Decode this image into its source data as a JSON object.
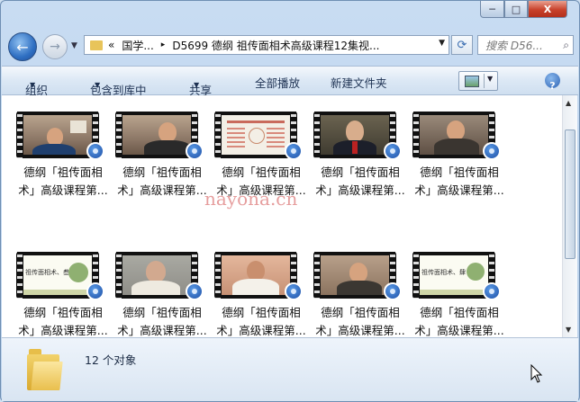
{
  "window": {
    "controls": {
      "minimize": "─",
      "maximize": "□",
      "close": "X"
    }
  },
  "nav": {
    "back_icon": "←",
    "forward_icon": "→",
    "history_dropdown": "▼"
  },
  "address": {
    "overflow": "«",
    "segment1": "国学...",
    "separator": "▸",
    "segment2": "D5699 德纲 祖传面相术高级课程12集视...",
    "dropdown": "▼"
  },
  "refresh_icon": "⟳",
  "search": {
    "placeholder": "搜索 D56...",
    "icon": "⌕"
  },
  "toolbar": {
    "organize": "组织",
    "include_in_library": "包含到库中",
    "share": "共享",
    "play_all": "全部播放",
    "new_folder": "新建文件夹",
    "dropdown_arrow": "▼",
    "help": "?"
  },
  "files": [
    {
      "line1": "德纲「祖传面相",
      "line2": "术」高级课程第..."
    },
    {
      "line1": "德纲「祖传面相",
      "line2": "术」高级课程第..."
    },
    {
      "line1": "德纲「祖传面相",
      "line2": "术」高级课程第..."
    },
    {
      "line1": "德纲「祖传面相",
      "line2": "术」高级课程第..."
    },
    {
      "line1": "德纲「祖传面相",
      "line2": "术」高级课程第..."
    },
    {
      "line1": "德纲「祖传面相",
      "line2": "术」高级课程第..."
    },
    {
      "line1": "德纲「祖传面相",
      "line2": "术」高级课程第..."
    },
    {
      "line1": "德纲「祖传面相",
      "line2": "术」高级课程第..."
    },
    {
      "line1": "德纲「祖传面相",
      "line2": "术」高级课程第..."
    },
    {
      "line1": "德纲「祖传面相",
      "line2": "术」高级课程第..."
    }
  ],
  "slide_text": {
    "a": "祖传面相术、叁",
    "b": "祖传面相术、肆"
  },
  "watermark": "nayona.cn",
  "status": {
    "count": "12 个对象"
  },
  "scrollbar": {
    "up": "▲",
    "down": "▼"
  }
}
